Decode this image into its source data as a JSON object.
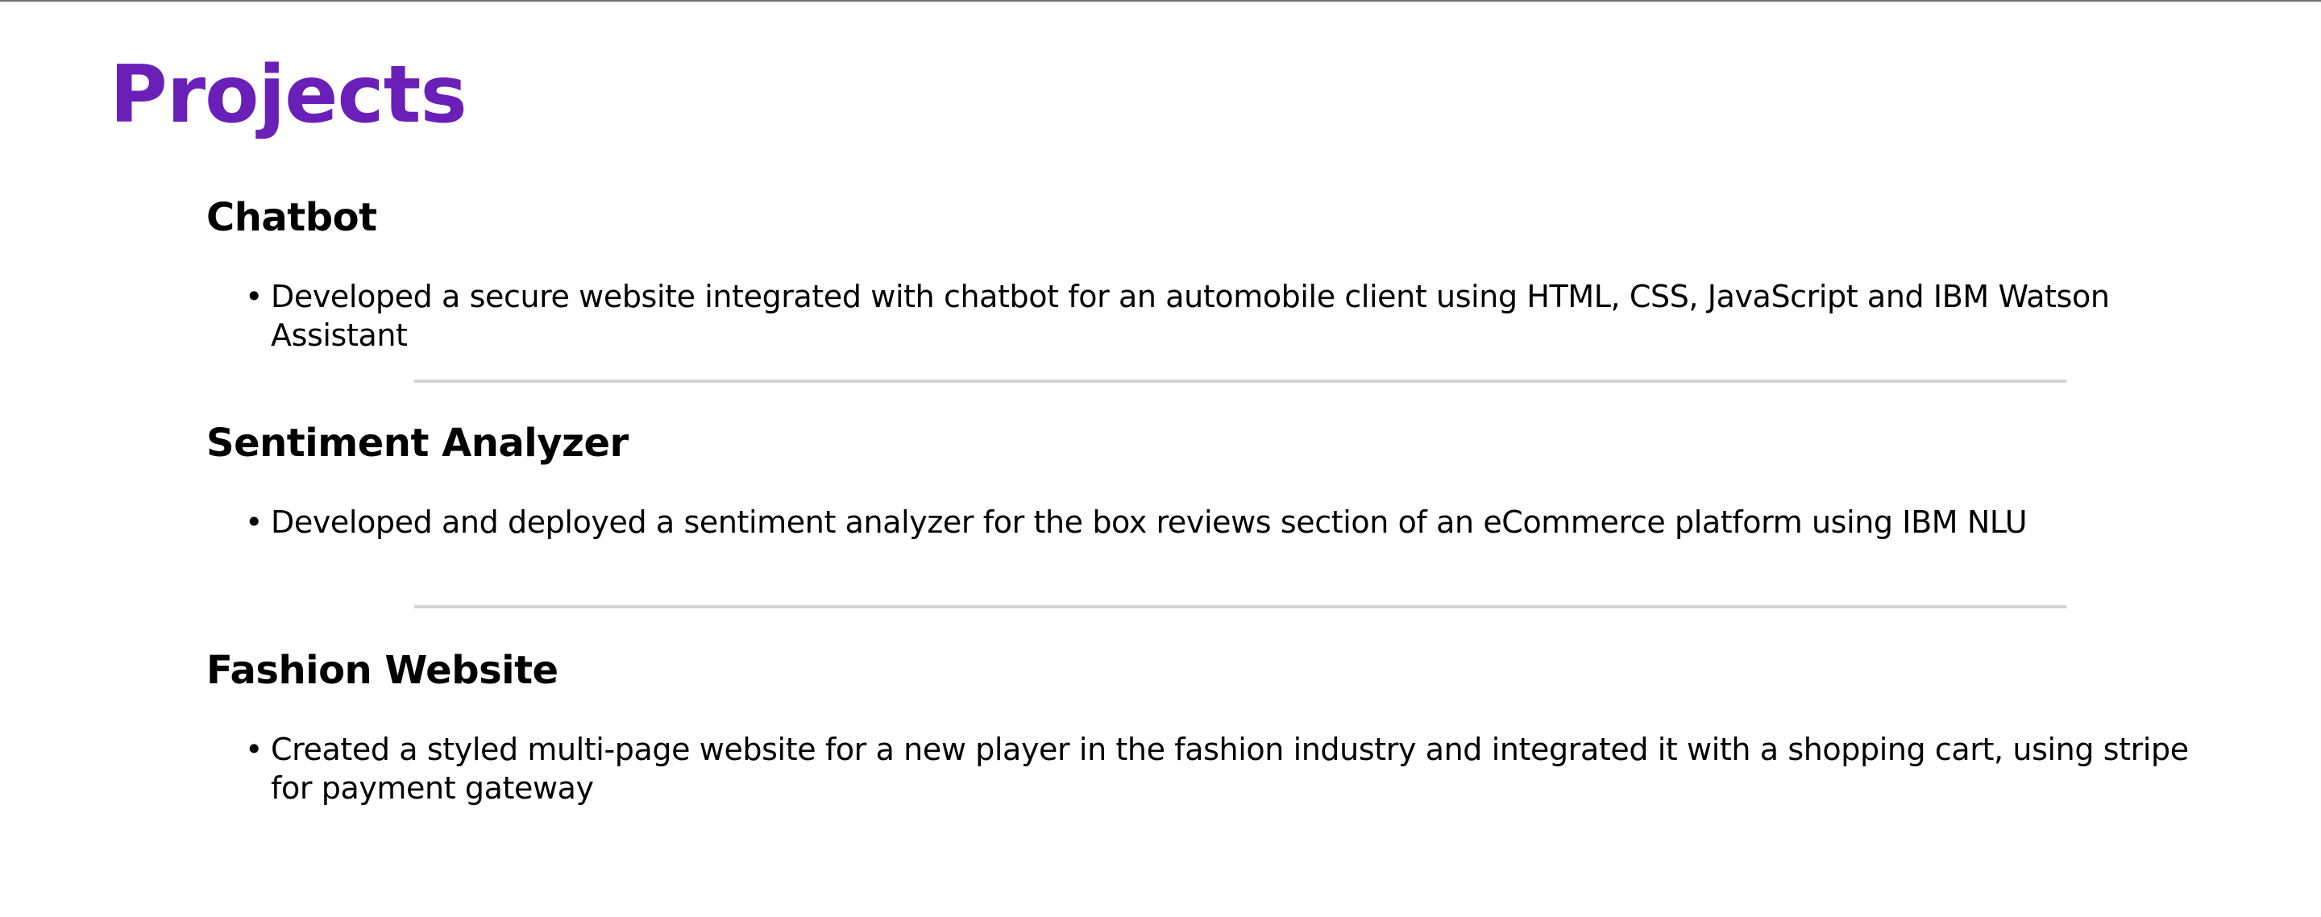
{
  "page": {
    "title": "Projects",
    "accent_color": "#6a1fb9"
  },
  "projects": [
    {
      "title": "Chatbot",
      "items": [
        "Developed a secure website integrated with chatbot for an automobile client using HTML, CSS, JavaScript and IBM Watson Assistant"
      ]
    },
    {
      "title": "Sentiment Analyzer",
      "items": [
        "Developed and deployed a sentiment analyzer for the box reviews section of an eCommerce platform using IBM NLU"
      ]
    },
    {
      "title": "Fashion Website",
      "items": [
        "Created a styled multi-page website for a new player in the fashion industry and integrated it with a shopping cart, using stripe for payment gateway"
      ]
    }
  ],
  "divider_color": "#d3d3d3",
  "bullet_glyph": "•"
}
